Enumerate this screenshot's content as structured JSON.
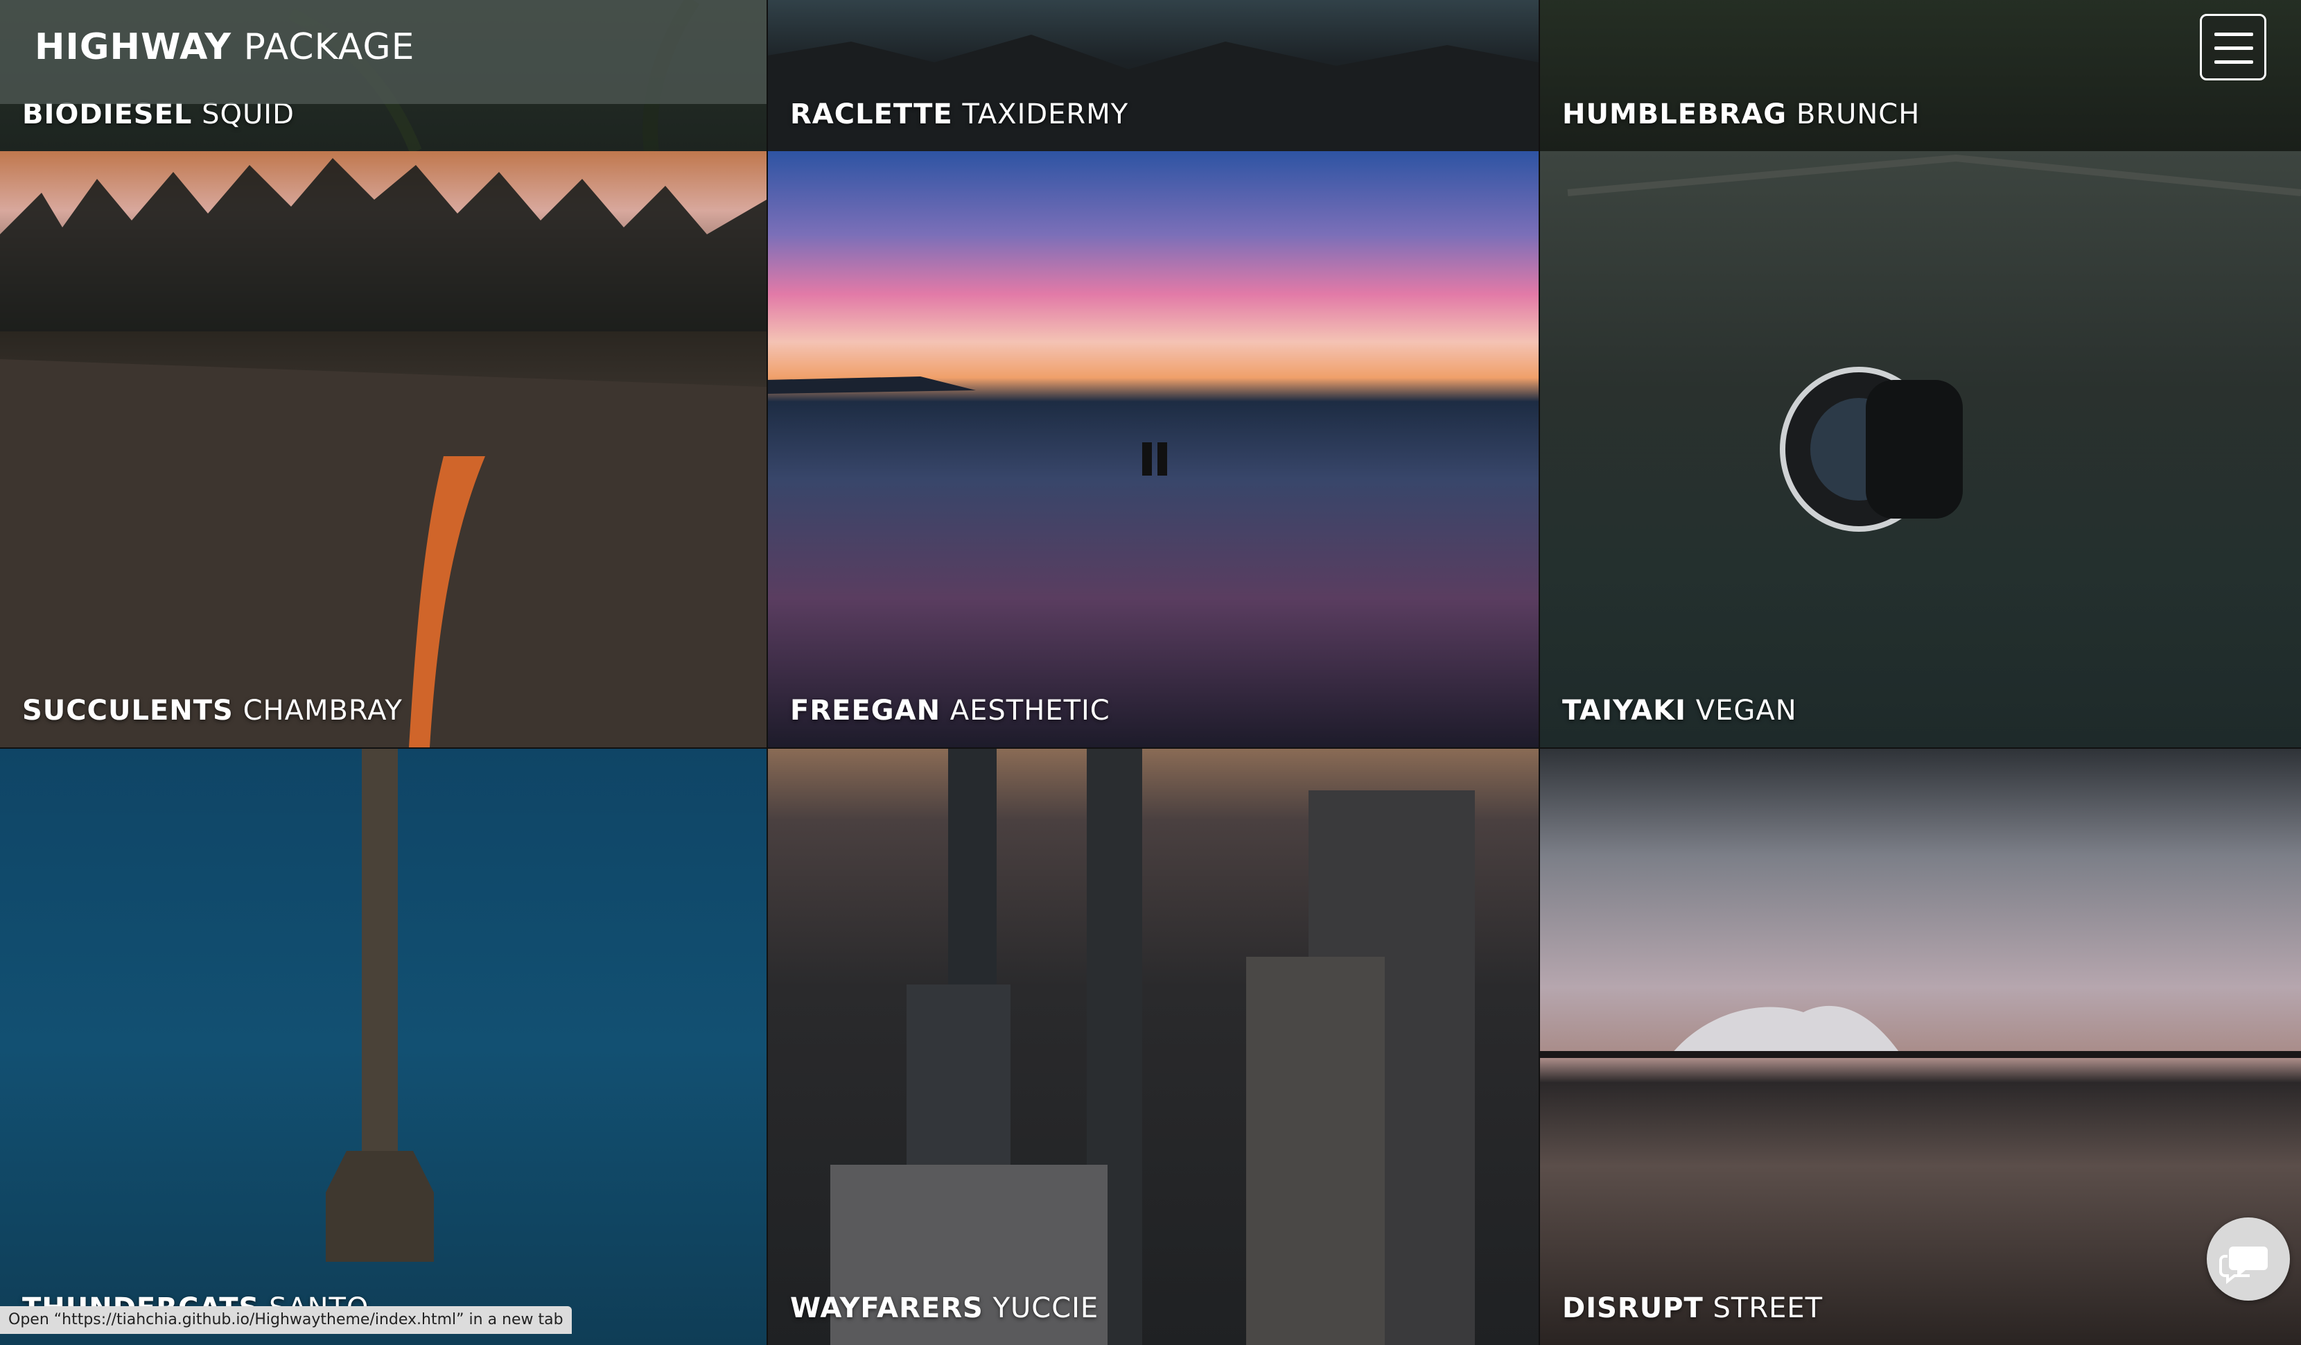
{
  "header": {
    "brand_bold": "HIGHWAY",
    "brand_light": "PACKAGE"
  },
  "tiles": [
    {
      "bold": "BIODIESEL",
      "light": "SQUID"
    },
    {
      "bold": "RACLETTE",
      "light": "TAXIDERMY"
    },
    {
      "bold": "HUMBLEBRAG",
      "light": "BRUNCH"
    },
    {
      "bold": "SUCCULENTS",
      "light": "CHAMBRAY"
    },
    {
      "bold": "FREEGAN",
      "light": "AESTHETIC"
    },
    {
      "bold": "TAIYAKI",
      "light": "VEGAN"
    },
    {
      "bold": "THUNDERCATS",
      "light": "SANTO"
    },
    {
      "bold": "WAYFARERS",
      "light": "YUCCIE"
    },
    {
      "bold": "DISRUPT",
      "light": "STREET"
    }
  ],
  "status_bar": {
    "text": "Open “https://tiahchia.github.io/Highwaytheme/index.html” in a new tab"
  },
  "icons": {
    "menu": "hamburger-menu-icon",
    "chat": "chat-bubble-icon"
  }
}
